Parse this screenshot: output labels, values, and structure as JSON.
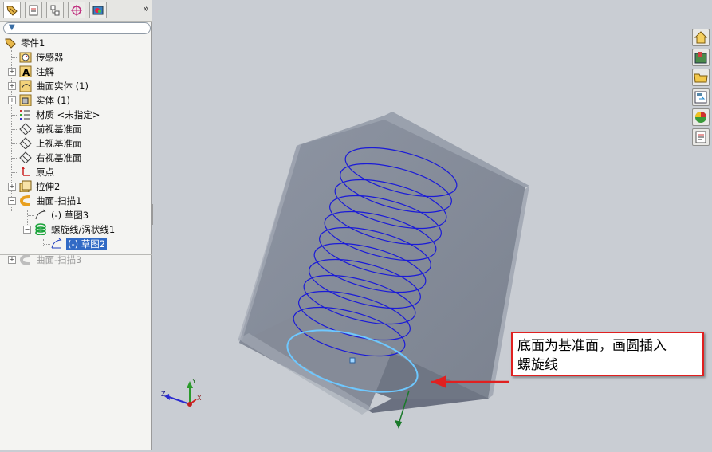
{
  "feature_tree": {
    "tabs": [
      "feature-manager",
      "property-manager",
      "configuration-manager",
      "dimxpert-manager",
      "display-manager"
    ],
    "collapse_symbol": "»",
    "items": [
      {
        "label": "零件1"
      },
      {
        "label": "传感器"
      },
      {
        "label": "注解"
      },
      {
        "label": "曲面实体 (1)"
      },
      {
        "label": "实体 (1)"
      },
      {
        "label": "材质 <未指定>"
      },
      {
        "label": "前视基准面"
      },
      {
        "label": "上视基准面"
      },
      {
        "label": "右视基准面"
      },
      {
        "label": "原点"
      },
      {
        "label": "拉伸2"
      },
      {
        "label": "曲面-扫描1"
      },
      {
        "label": "(-) 草图3"
      },
      {
        "label": "螺旋线/涡状线1"
      },
      {
        "label": "(-) 草图2"
      },
      {
        "label": "曲面-扫描3"
      }
    ]
  },
  "callout": {
    "line1": "底面为基准面，画圆插入",
    "line2": "螺旋线"
  },
  "triad": {
    "x": "X",
    "y": "Y",
    "z": "Z"
  },
  "colors": {
    "selection": "#316ac5",
    "helix": "#1a1ad8",
    "callout_border": "#e02020",
    "viewport_bg": "#c9cdd3"
  }
}
